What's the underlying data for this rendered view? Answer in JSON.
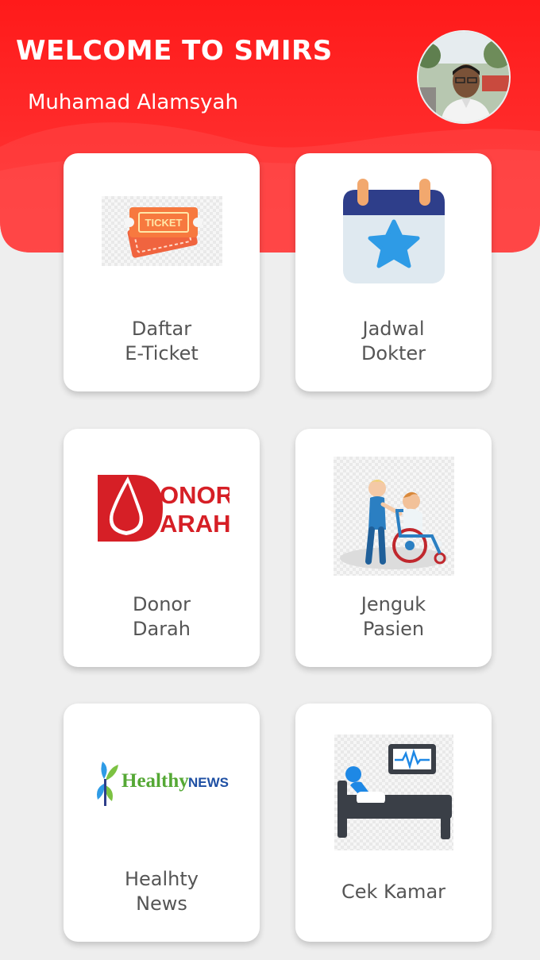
{
  "header": {
    "title": "WELCOME TO SMIRS",
    "user_name": "Muhamad Alamsyah",
    "brand_color": "#fe1c1c",
    "avatar_icon": "user-avatar-photo"
  },
  "menu": {
    "items": [
      {
        "line1": "Daftar",
        "line2": "E-Ticket",
        "icon": "ticket-icon",
        "icon_text": "TICKET"
      },
      {
        "line1": "Jadwal",
        "line2": "Dokter",
        "icon": "calendar-star-icon"
      },
      {
        "line1": "Donor",
        "line2": "Darah",
        "icon": "donor-darah-logo",
        "logo_line1": "ONOR",
        "logo_line2": "ARAH"
      },
      {
        "line1": "Jenguk",
        "line2": "Pasien",
        "icon": "wheelchair-patient-icon"
      },
      {
        "line1": "Healhty",
        "line2": "News",
        "icon": "healthy-news-logo",
        "logo_word1": "Healthy",
        "logo_word2": "NEWS"
      },
      {
        "line1": "Cek Kamar",
        "icon": "hospital-bed-monitor-icon"
      }
    ]
  }
}
